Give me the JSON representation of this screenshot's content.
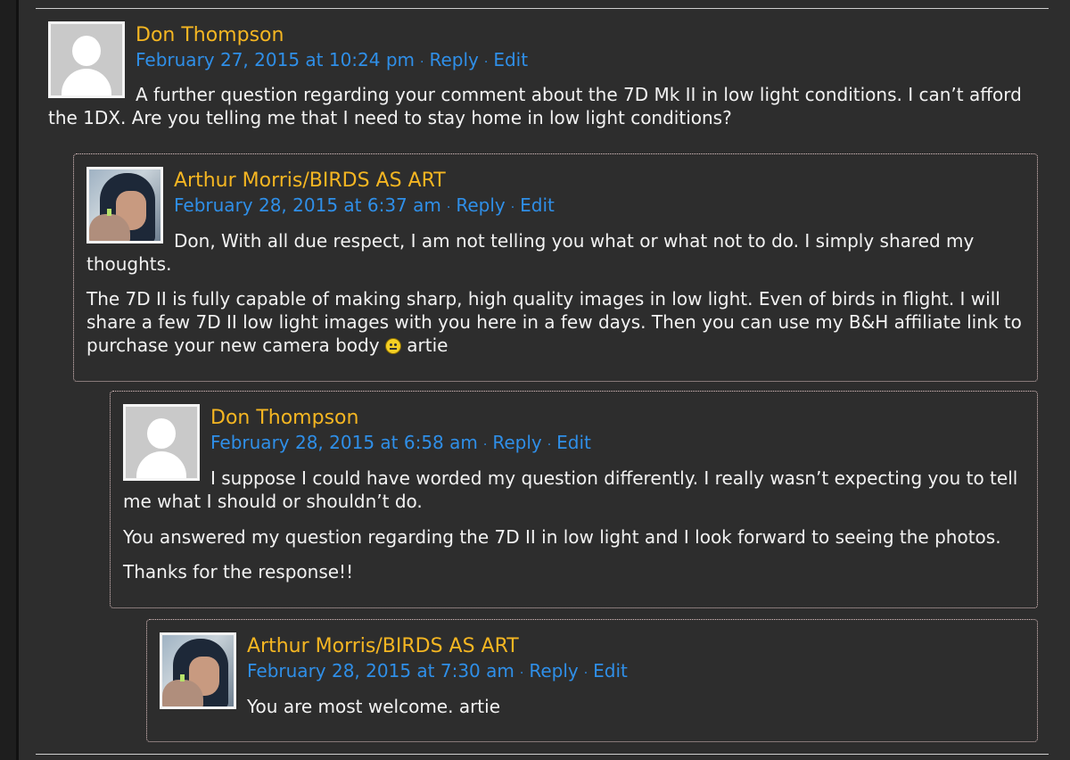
{
  "comments": [
    {
      "author": "Don Thompson",
      "date": "February 27, 2015 at 10:24 pm",
      "reply": "Reply",
      "edit": "Edit",
      "paragraphs": [
        "A further question regarding your comment about the 7D Mk II in low light conditions. I can’t afford the 1DX. Are you telling me that I need to stay home in low light conditions?"
      ]
    },
    {
      "author": "Arthur Morris/BIRDS AS ART",
      "date": "February 28, 2015 at 6:37 am",
      "reply": "Reply",
      "edit": "Edit",
      "paragraphs": [
        "Don, With all due respect, I am not telling you what or what not to do. I simply shared my thoughts.",
        "The 7D II is fully capable of making sharp, high quality images in low light. Even of birds in flight. I will share a few 7D II low light images with you here in a few days. Then you can use my B&H affiliate link to purchase your new camera body",
        "artie"
      ]
    },
    {
      "author": "Don Thompson",
      "date": "February 28, 2015 at 6:58 am",
      "reply": "Reply",
      "edit": "Edit",
      "paragraphs": [
        "I suppose I could have worded my question differently. I really wasn’t expecting you to tell me what I should or shouldn’t do.",
        "You answered my question regarding the 7D II in low light and I look forward to seeing the photos.",
        "Thanks for the response!!"
      ]
    },
    {
      "author": "Arthur Morris/BIRDS AS ART",
      "date": "February 28, 2015 at 7:30 am",
      "reply": "Reply",
      "edit": "Edit",
      "paragraphs": [
        "You are most welcome. artie"
      ]
    }
  ],
  "icons": {
    "default_avatar": "default-avatar-icon",
    "photo_avatar": "user-photo-avatar",
    "smiley": "smiley-emoji-icon"
  },
  "colors": {
    "background": "#2d2d2d",
    "author": "#f5b622",
    "link": "#2f8fe8",
    "text": "#f2f2f2"
  }
}
